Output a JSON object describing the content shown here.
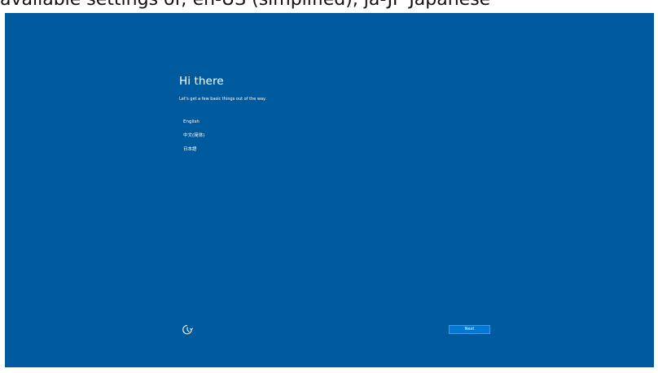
{
  "caption": {
    "text": "available settings of; en-US (simplified), ja-JP Japanese"
  },
  "screen": {
    "background_color": "#005a9e",
    "title": "Hi there",
    "subtitle": "Let's get a few basic things out of the way.",
    "languages": [
      {
        "label": "English"
      },
      {
        "label": "中文(简体)"
      },
      {
        "label": "日本語"
      }
    ],
    "accessibility_icon": "ease-of-access-icon",
    "next_button": {
      "label": "Next",
      "color": "#0078d7"
    }
  }
}
